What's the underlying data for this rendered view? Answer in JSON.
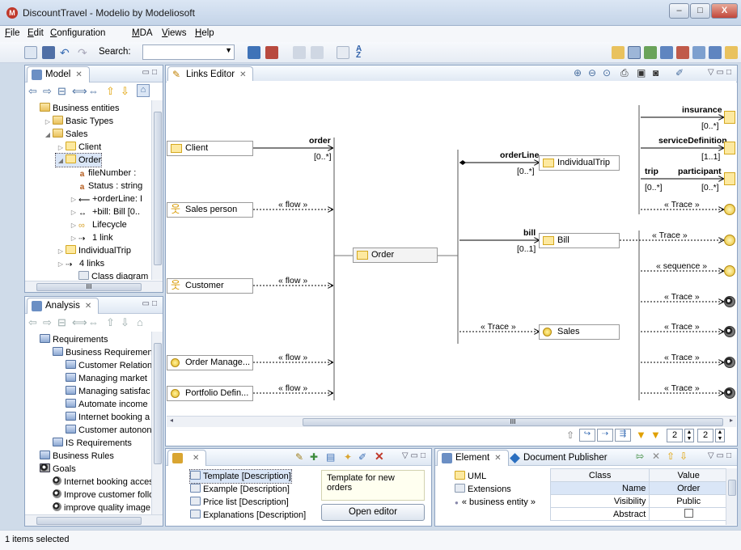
{
  "window": {
    "title": "DiscountTravel - Modelio by Modeliosoft",
    "min": "–",
    "max": "□",
    "close": "X"
  },
  "menu": [
    "File",
    "Edit",
    "Configuration",
    "MDA",
    "Views",
    "Help"
  ],
  "toolbar": {
    "search_label": "Search:",
    "search_value": ""
  },
  "model_panel": {
    "tab": "Model",
    "tree": [
      {
        "label": "Business entities",
        "icon": "folder",
        "depth": 0,
        "exp": ""
      },
      {
        "label": "Basic Types",
        "icon": "folder",
        "depth": 1,
        "exp": "▷"
      },
      {
        "label": "Sales",
        "icon": "folder",
        "depth": 1,
        "exp": "◢"
      },
      {
        "label": "Client",
        "icon": "cls",
        "depth": 2,
        "exp": "▷"
      },
      {
        "label": "Order",
        "icon": "cls",
        "depth": 2,
        "exp": "◢",
        "selected": true
      },
      {
        "label": "fileNumber :",
        "icon": "attr",
        "depth": 3,
        "exp": ""
      },
      {
        "label": "Status : string",
        "icon": "attr",
        "depth": 3,
        "exp": ""
      },
      {
        "label": "+orderLine: I",
        "icon": "assoc",
        "depth": 3,
        "exp": "▷"
      },
      {
        "label": "+bill: Bill [0..",
        "icon": "assoc2",
        "depth": 3,
        "exp": "▷"
      },
      {
        "label": "Lifecycle",
        "icon": "life",
        "depth": 3,
        "exp": "▷"
      },
      {
        "label": "1 link",
        "icon": "link",
        "depth": 3,
        "exp": "▷"
      },
      {
        "label": "IndividualTrip",
        "icon": "cls",
        "depth": 2,
        "exp": "▷"
      },
      {
        "label": "4 links",
        "icon": "link",
        "depth": 2,
        "exp": "▷"
      },
      {
        "label": "Class diagram",
        "icon": "diag",
        "depth": 3,
        "exp": ""
      }
    ]
  },
  "analysis_panel": {
    "tab": "Analysis",
    "tree": [
      {
        "label": "Requirements",
        "icon": "req",
        "depth": 0
      },
      {
        "label": "Business Requirements",
        "icon": "req",
        "depth": 1
      },
      {
        "label": "Customer Relation",
        "icon": "req",
        "depth": 2
      },
      {
        "label": "Managing market",
        "icon": "req",
        "depth": 2
      },
      {
        "label": "Managing satisfac",
        "icon": "req",
        "depth": 2
      },
      {
        "label": "Automate income",
        "icon": "req",
        "depth": 2
      },
      {
        "label": "Internet booking a",
        "icon": "req",
        "depth": 2
      },
      {
        "label": "Customer autonon",
        "icon": "req",
        "depth": 2
      },
      {
        "label": "IS Requirements",
        "icon": "req",
        "depth": 1
      },
      {
        "label": "Business Rules",
        "icon": "req",
        "depth": 0
      },
      {
        "label": "Goals",
        "icon": "goalsfolder",
        "depth": 0
      },
      {
        "label": "Internet booking acces",
        "icon": "goal",
        "depth": 1
      },
      {
        "label": "Improve customer follo",
        "icon": "goal",
        "depth": 1
      },
      {
        "label": "improve quality image",
        "icon": "goal",
        "depth": 1
      }
    ]
  },
  "links_editor": {
    "tab": "Links Editor",
    "left_nodes": [
      {
        "label": "Client",
        "kind": "class",
        "link": "order",
        "mult": "[0..*]"
      },
      {
        "label": "Sales person",
        "kind": "actor",
        "link": "« flow »",
        "mult": ""
      },
      {
        "label": "Customer",
        "kind": "actor",
        "link": "« flow »",
        "mult": ""
      },
      {
        "label": "Order Manage...",
        "kind": "goal",
        "link": "« flow »",
        "mult": ""
      },
      {
        "label": "Portfolio Defin...",
        "kind": "goal",
        "link": "« flow »",
        "mult": ""
      }
    ],
    "center": "Order",
    "mid_nodes": [
      {
        "label": "IndividualTrip",
        "kind": "class",
        "link": "orderLine",
        "mult": "[0..*]"
      },
      {
        "label": "Bill",
        "kind": "class",
        "link": "bill",
        "mult": "[0..1]"
      },
      {
        "label": "Sales",
        "kind": "goal",
        "link": "« Trace »",
        "mult": ""
      }
    ],
    "right_links": [
      {
        "label": "insurance",
        "mult": "[0..*]",
        "kind": "cls"
      },
      {
        "label": "serviceDefinition",
        "mult": "[1..1]",
        "kind": "cls"
      },
      {
        "label": "participant",
        "mult": "[0..*]",
        "kind": "cls",
        "extra": "trip",
        "extra_mult": "[0..*]"
      },
      {
        "label": "« Trace »",
        "mult": "",
        "kind": "yc"
      },
      {
        "label": "« Trace »",
        "mult": "",
        "kind": "yc"
      },
      {
        "label": "« sequence »",
        "mult": "",
        "kind": "yc"
      },
      {
        "label": "« Trace »",
        "mult": "",
        "kind": "dc"
      },
      {
        "label": "« Trace »",
        "mult": "",
        "kind": "dc"
      },
      {
        "label": "« Trace »",
        "mult": "",
        "kind": "dc"
      },
      {
        "label": "« Trace »",
        "mult": "",
        "kind": "dc"
      }
    ],
    "scroll_label": "III",
    "depth_left": "2",
    "depth_right": "2"
  },
  "notes_panel": {
    "items": [
      "Template [Description]",
      "Example [Description]",
      "Price list [Description]",
      "Explanations [Description]"
    ],
    "note_text": "Template for new orders",
    "open_editor": "Open editor"
  },
  "element_panel": {
    "tab": "Element",
    "tab2": "Document Publisher",
    "left_items": [
      "UML",
      "Extensions",
      "« business entity »"
    ],
    "columns": [
      "Class",
      "Value"
    ],
    "rows": [
      {
        "key": "Name",
        "value": "Order"
      },
      {
        "key": "Visibility",
        "value": "Public"
      },
      {
        "key": "Abstract",
        "value": ""
      }
    ]
  },
  "status": "1 items selected"
}
